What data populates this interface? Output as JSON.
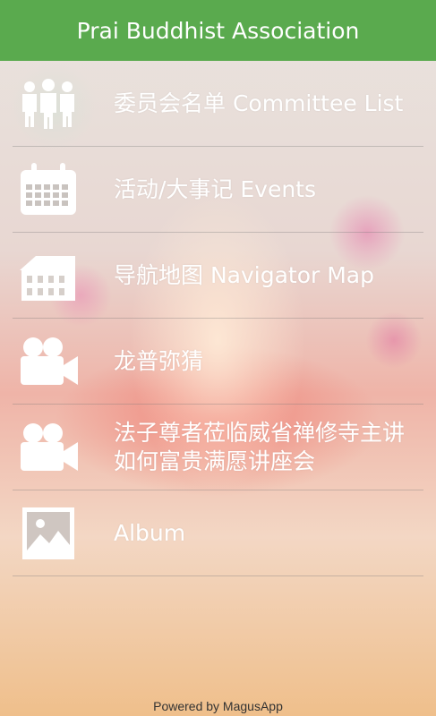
{
  "header": {
    "title": "Prai Buddhist Association"
  },
  "menu": [
    {
      "label": "委员会名单 Committee List",
      "icon": "committee-icon"
    },
    {
      "label": "活动/大事记 Events",
      "icon": "calendar-icon"
    },
    {
      "label": "导航地图 Navigator Map",
      "icon": "building-icon"
    },
    {
      "label": "龙普弥猜",
      "icon": "video-camera-icon"
    },
    {
      "label": "法子尊者莅临威省禅修寺主讲如何富贵满愿讲座会",
      "icon": "video-camera-icon"
    },
    {
      "label": "Album",
      "icon": "image-icon"
    }
  ],
  "footer": {
    "text": "Powered by MagusApp"
  },
  "colors": {
    "header_bg": "#5aaa4e",
    "text": "#ffffff"
  }
}
